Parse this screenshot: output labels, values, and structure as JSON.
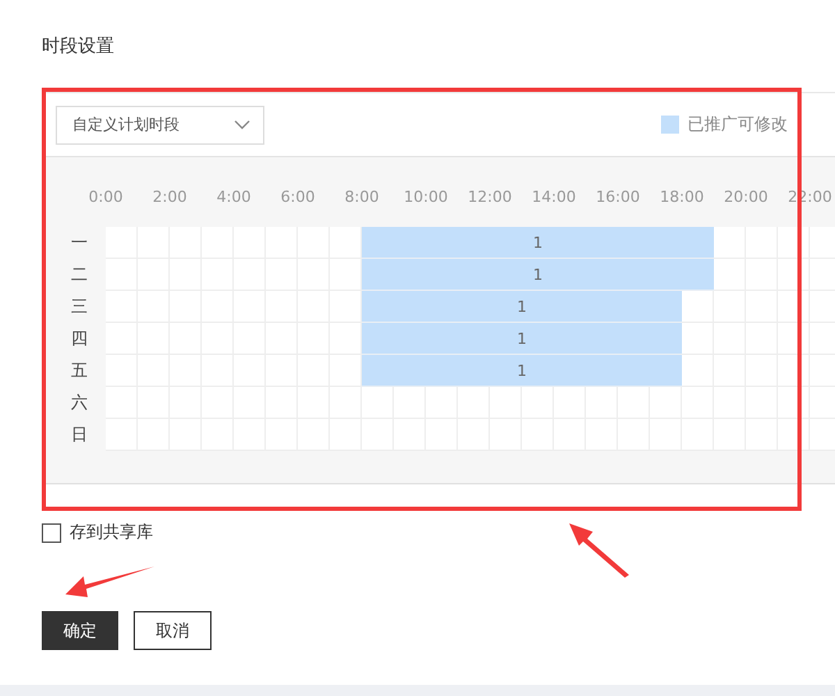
{
  "title": "时段设置",
  "dropdown": {
    "value": "自定义计划时段"
  },
  "legend": {
    "label": "已推广可修改",
    "color": "#c3dffb"
  },
  "hours": [
    "0:00",
    "2:00",
    "4:00",
    "6:00",
    "8:00",
    "10:00",
    "12:00",
    "14:00",
    "16:00",
    "18:00",
    "20:00",
    "22:00"
  ],
  "days": [
    {
      "label": "一",
      "block_label": "1",
      "slots": [
        false,
        false,
        false,
        false,
        false,
        false,
        false,
        false,
        true,
        true,
        true,
        true,
        true,
        true,
        true,
        true,
        true,
        true,
        true,
        false,
        false,
        false,
        false
      ]
    },
    {
      "label": "二",
      "block_label": "1",
      "slots": [
        false,
        false,
        false,
        false,
        false,
        false,
        false,
        false,
        true,
        true,
        true,
        true,
        true,
        true,
        true,
        true,
        true,
        true,
        true,
        false,
        false,
        false,
        false
      ]
    },
    {
      "label": "三",
      "block_label": "1",
      "slots": [
        false,
        false,
        false,
        false,
        false,
        false,
        false,
        false,
        true,
        true,
        true,
        true,
        true,
        true,
        true,
        true,
        true,
        true,
        false,
        false,
        false,
        false,
        false
      ]
    },
    {
      "label": "四",
      "block_label": "1",
      "slots": [
        false,
        false,
        false,
        false,
        false,
        false,
        false,
        false,
        true,
        true,
        true,
        true,
        true,
        true,
        true,
        true,
        true,
        true,
        false,
        false,
        false,
        false,
        false
      ]
    },
    {
      "label": "五",
      "block_label": "1",
      "slots": [
        false,
        false,
        false,
        false,
        false,
        false,
        false,
        false,
        true,
        true,
        true,
        true,
        true,
        true,
        true,
        true,
        true,
        true,
        false,
        false,
        false,
        false,
        false
      ]
    },
    {
      "label": "六",
      "slots": [
        false,
        false,
        false,
        false,
        false,
        false,
        false,
        false,
        false,
        false,
        false,
        false,
        false,
        false,
        false,
        false,
        false,
        false,
        false,
        false,
        false,
        false,
        false
      ]
    },
    {
      "label": "日",
      "slots": [
        false,
        false,
        false,
        false,
        false,
        false,
        false,
        false,
        false,
        false,
        false,
        false,
        false,
        false,
        false,
        false,
        false,
        false,
        false,
        false,
        false,
        false,
        false
      ]
    }
  ],
  "share_checkbox": {
    "label": "存到共享库",
    "checked": false
  },
  "buttons": [
    {
      "label": "确定",
      "kind": "primary"
    },
    {
      "label": "取消",
      "kind": "secondary"
    }
  ]
}
